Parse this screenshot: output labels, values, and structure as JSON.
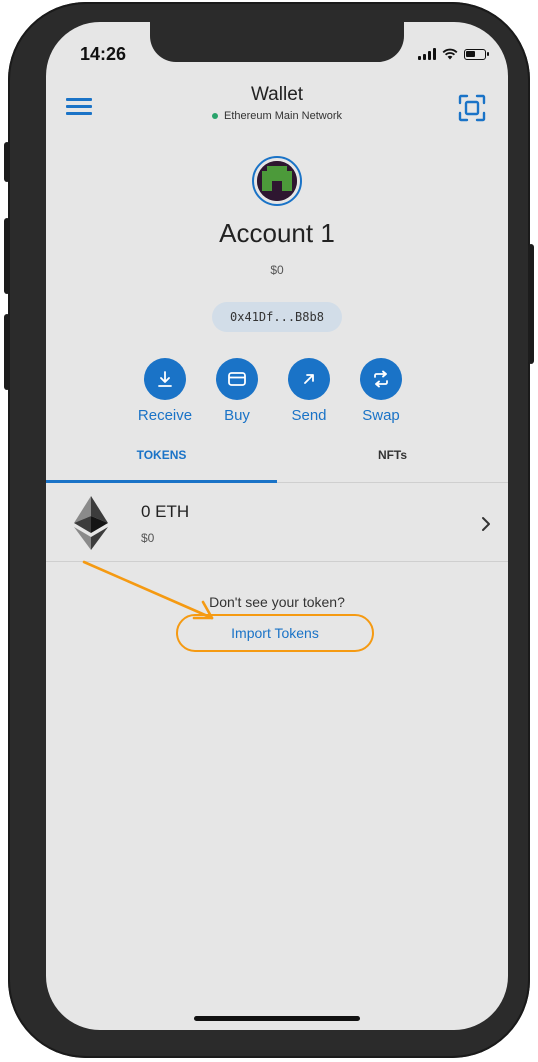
{
  "status_bar": {
    "time": "14:26"
  },
  "header": {
    "title": "Wallet",
    "network": "Ethereum Main Network"
  },
  "account": {
    "name": "Account 1",
    "balance": "$0",
    "address": "0x41Df...B8b8"
  },
  "actions": [
    {
      "label": "Receive",
      "icon": "download-icon"
    },
    {
      "label": "Buy",
      "icon": "card-icon"
    },
    {
      "label": "Send",
      "icon": "arrow-up-right-icon"
    },
    {
      "label": "Swap",
      "icon": "swap-icon"
    }
  ],
  "tabs": [
    {
      "label": "TOKENS",
      "active": true
    },
    {
      "label": "NFTs",
      "active": false
    }
  ],
  "tokens": [
    {
      "name": "0 ETH",
      "value": "$0",
      "icon": "ethereum-icon"
    }
  ],
  "import": {
    "prompt": "Don't see your token?",
    "link_label": "Import Tokens"
  },
  "colors": {
    "accent": "#1a73c7",
    "highlight": "#f59a12",
    "network_dot": "#28a36b",
    "screen_bg": "#e6e6e6"
  }
}
